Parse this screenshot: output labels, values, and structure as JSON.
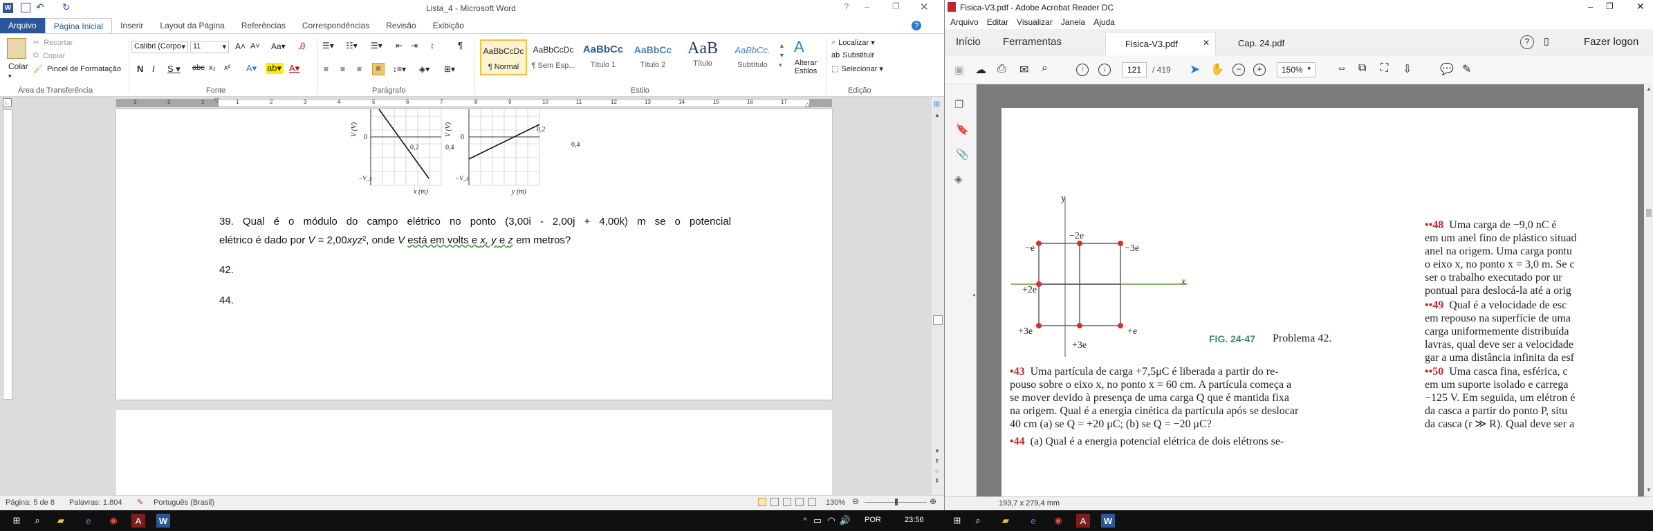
{
  "word": {
    "title": "Lista_4 - Microsoft Word",
    "tabs": [
      "Arquivo",
      "Página Inicial",
      "Inserir",
      "Layout da Página",
      "Referências",
      "Correspondências",
      "Revisão",
      "Exibição"
    ],
    "clipboard": {
      "paste": "Colar",
      "cut": "Recortar",
      "copy": "Copiar",
      "format_painter": "Pincel de Formatação",
      "group": "Área de Transferência"
    },
    "font": {
      "name": "Calibri (Corpo",
      "size": "11",
      "group": "Fonte"
    },
    "paragraph_group": "Parágrafo",
    "styles": [
      {
        "preview": "AaBbCcDc",
        "label": "¶ Normal"
      },
      {
        "preview": "AaBbCcDc",
        "label": "¶ Sem Esp..."
      },
      {
        "preview": "AaBbCc",
        "label": "Título 1"
      },
      {
        "preview": "AaBbCc",
        "label": "Título 2"
      },
      {
        "preview": "AaB",
        "label": "Título"
      },
      {
        "preview": "AaBbCc.",
        "label": "Subtítulo"
      }
    ],
    "change_styles": "Alterar Estilos",
    "styles_group": "Estilo",
    "editing": {
      "find": "Localizar",
      "replace": "Substituir",
      "select": "Selecionar",
      "group": "Edição"
    },
    "ruler_numbers": [
      "3",
      "2",
      "1",
      "1",
      "2",
      "3",
      "4",
      "5",
      "6",
      "7",
      "8",
      "9",
      "10",
      "11",
      "12",
      "13",
      "14",
      "15",
      "16",
      "17"
    ],
    "graph1": {
      "ylabel": "V (V)",
      "xlabel": "x (m)",
      "t1": "0,2",
      "t2": "0,4",
      "zero": "0",
      "neg": "−V_s"
    },
    "graph2": {
      "ylabel": "V (V)",
      "xlabel": "y (m)",
      "t1": "0,2",
      "t2": "0,4",
      "zero": "0",
      "neg": "−V_s"
    },
    "q39_line1": "39. Qual é o módulo do campo elétrico no ponto (3,00i - 2,00j + 4,00k) m se o potencial",
    "q39_line2_a": "elétrico é dado por",
    "q39_line2_b": "V",
    "q39_line2_c": " = 2,00",
    "q39_line2_d": "xyz",
    "q39_line2_e": "², onde",
    "q39_line2_f": "V",
    "q39_line2_g": "está em volts e",
    "q39_line2_h": "x, y",
    "q39_line2_i": "e",
    "q39_line2_j": "z",
    "q39_line2_k": "em metros?",
    "q42": "42.",
    "q44": "44.",
    "status": {
      "page": "Página: 5 de 8",
      "words": "Palavras: 1.804",
      "language": "Português (Brasil)",
      "zoom": "130%"
    }
  },
  "acrobat": {
    "title": "Fisica-V3.pdf - Adobe Acrobat Reader DC",
    "menu": [
      "Arquivo",
      "Editar",
      "Visualizar",
      "Janela",
      "Ajuda"
    ],
    "nav": [
      "Início",
      "Ferramentas"
    ],
    "tabs": [
      {
        "label": "Fisica-V3.pdf"
      },
      {
        "label": "Cap. 24.pdf"
      }
    ],
    "login": "Fazer logon",
    "page_current": "121",
    "page_total": "/ 419",
    "zoom": "150%",
    "figure": {
      "axis_y": "y",
      "axis_x": "x",
      "charges": [
        "−2e",
        "−e",
        "−3e",
        "+2e",
        "+3e",
        "+e",
        "+3e"
      ],
      "caption_num": "FIG. 24-47",
      "caption_text": "Problema 42."
    },
    "p43": {
      "num": "•43",
      "lines": [
        "Uma partícula de carga +7,5μC é liberada a partir do re-",
        "pouso sobre o eixo x, no ponto x = 60 cm. A partícula começa a",
        "se mover devido à presença de uma carga Q que é mantida fixa",
        "na origem. Qual é a energia cinética da partícula após se deslocar",
        "40 cm (a) se Q = +20 μC; (b) se Q = −20 μC?"
      ]
    },
    "p44": {
      "num": "•44",
      "line": "(a) Qual é a energia potencial elétrica de dois elétrons se-"
    },
    "p48": {
      "num": "••48",
      "lines": [
        "Uma carga de −9,0 nC é",
        "em um anel fino de plástico situad",
        "anel na origem. Uma carga pontu",
        "o eixo x, no ponto x = 3,0 m. Se c",
        "ser o trabalho executado por ur",
        "pontual para deslocá-la até a orig"
      ]
    },
    "p49": {
      "num": "••49",
      "lines": [
        "Qual é a velocidade de esc",
        "em repouso na superfície de uma",
        "carga uniformemente distribuída",
        "lavras, qual deve ser a velocidade",
        "gar a uma distância infinita da esf"
      ]
    },
    "p50": {
      "num": "••50",
      "lines": [
        "Uma casca fina, esférica, c",
        "em um suporte isolado e carrega",
        "−125 V. Em seguida, um elétron é",
        "da casca a partir do ponto P, situ",
        "da casca (r ≫ R). Qual deve ser a"
      ]
    },
    "status_dims": "193,7 x 279,4 mm"
  },
  "taskbar": {
    "lang": "POR",
    "time": "23:56"
  },
  "colors": {
    "word_blue": "#2b579a",
    "acro_red": "#c0272d",
    "figure_red": "#d9302a",
    "figure_green": "#6a9a3a"
  }
}
